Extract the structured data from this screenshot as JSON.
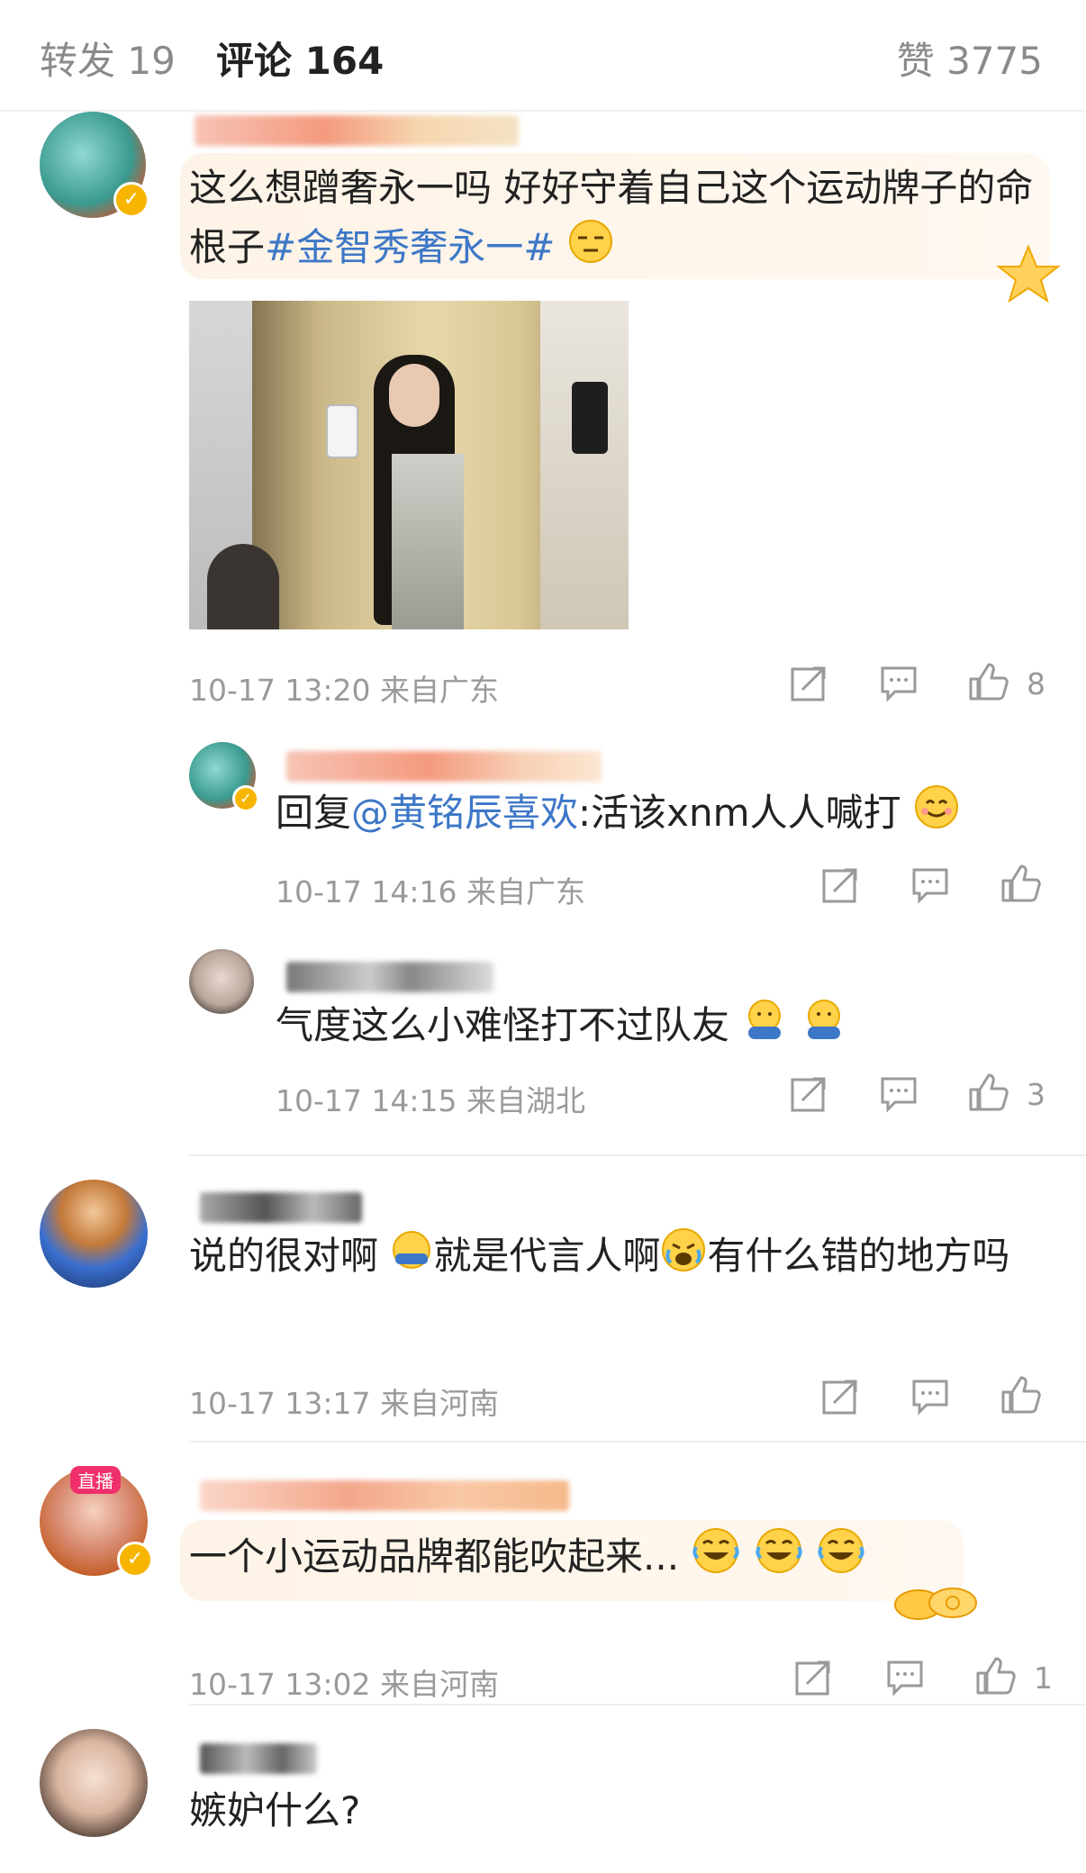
{
  "tabs": {
    "repost": "转发 19",
    "comments": "评论 164",
    "likes": "赞 3775"
  },
  "comments": [
    {
      "text": "这么想蹭奢永一吗 好好守着自己这个运动牌子的命根子",
      "hashtag": "#金智秀奢永一#",
      "meta": "10-17 13:20 来自广东",
      "like_count": "8",
      "replies": [
        {
          "prefix": "回复",
          "mention": "@黄铭辰喜欢",
          "text": ":活该xnm人人喊打",
          "meta": "10-17 14:16 来自广东",
          "like_count": ""
        },
        {
          "text": "气度这么小难怪打不过队友",
          "meta": "10-17 14:15 来自湖北",
          "like_count": "3"
        }
      ]
    },
    {
      "text_a": "说的很对啊",
      "text_b": "就是代言人啊",
      "text_c": "有什么错的地方吗",
      "meta": "10-17 13:17 来自河南",
      "like_count": ""
    },
    {
      "text": "一个小运动品牌都能吹起来...",
      "avatar_badge": "直播",
      "meta": "10-17 13:02 来自河南",
      "like_count": "1"
    },
    {
      "text": "嫉妒什么?"
    }
  ],
  "icons": [
    "share-icon",
    "comment-icon",
    "like-icon",
    "verified-badge-icon"
  ],
  "colors": {
    "link": "#3d77c7",
    "meta": "#9a9a9a",
    "badge": "#f7b500"
  }
}
